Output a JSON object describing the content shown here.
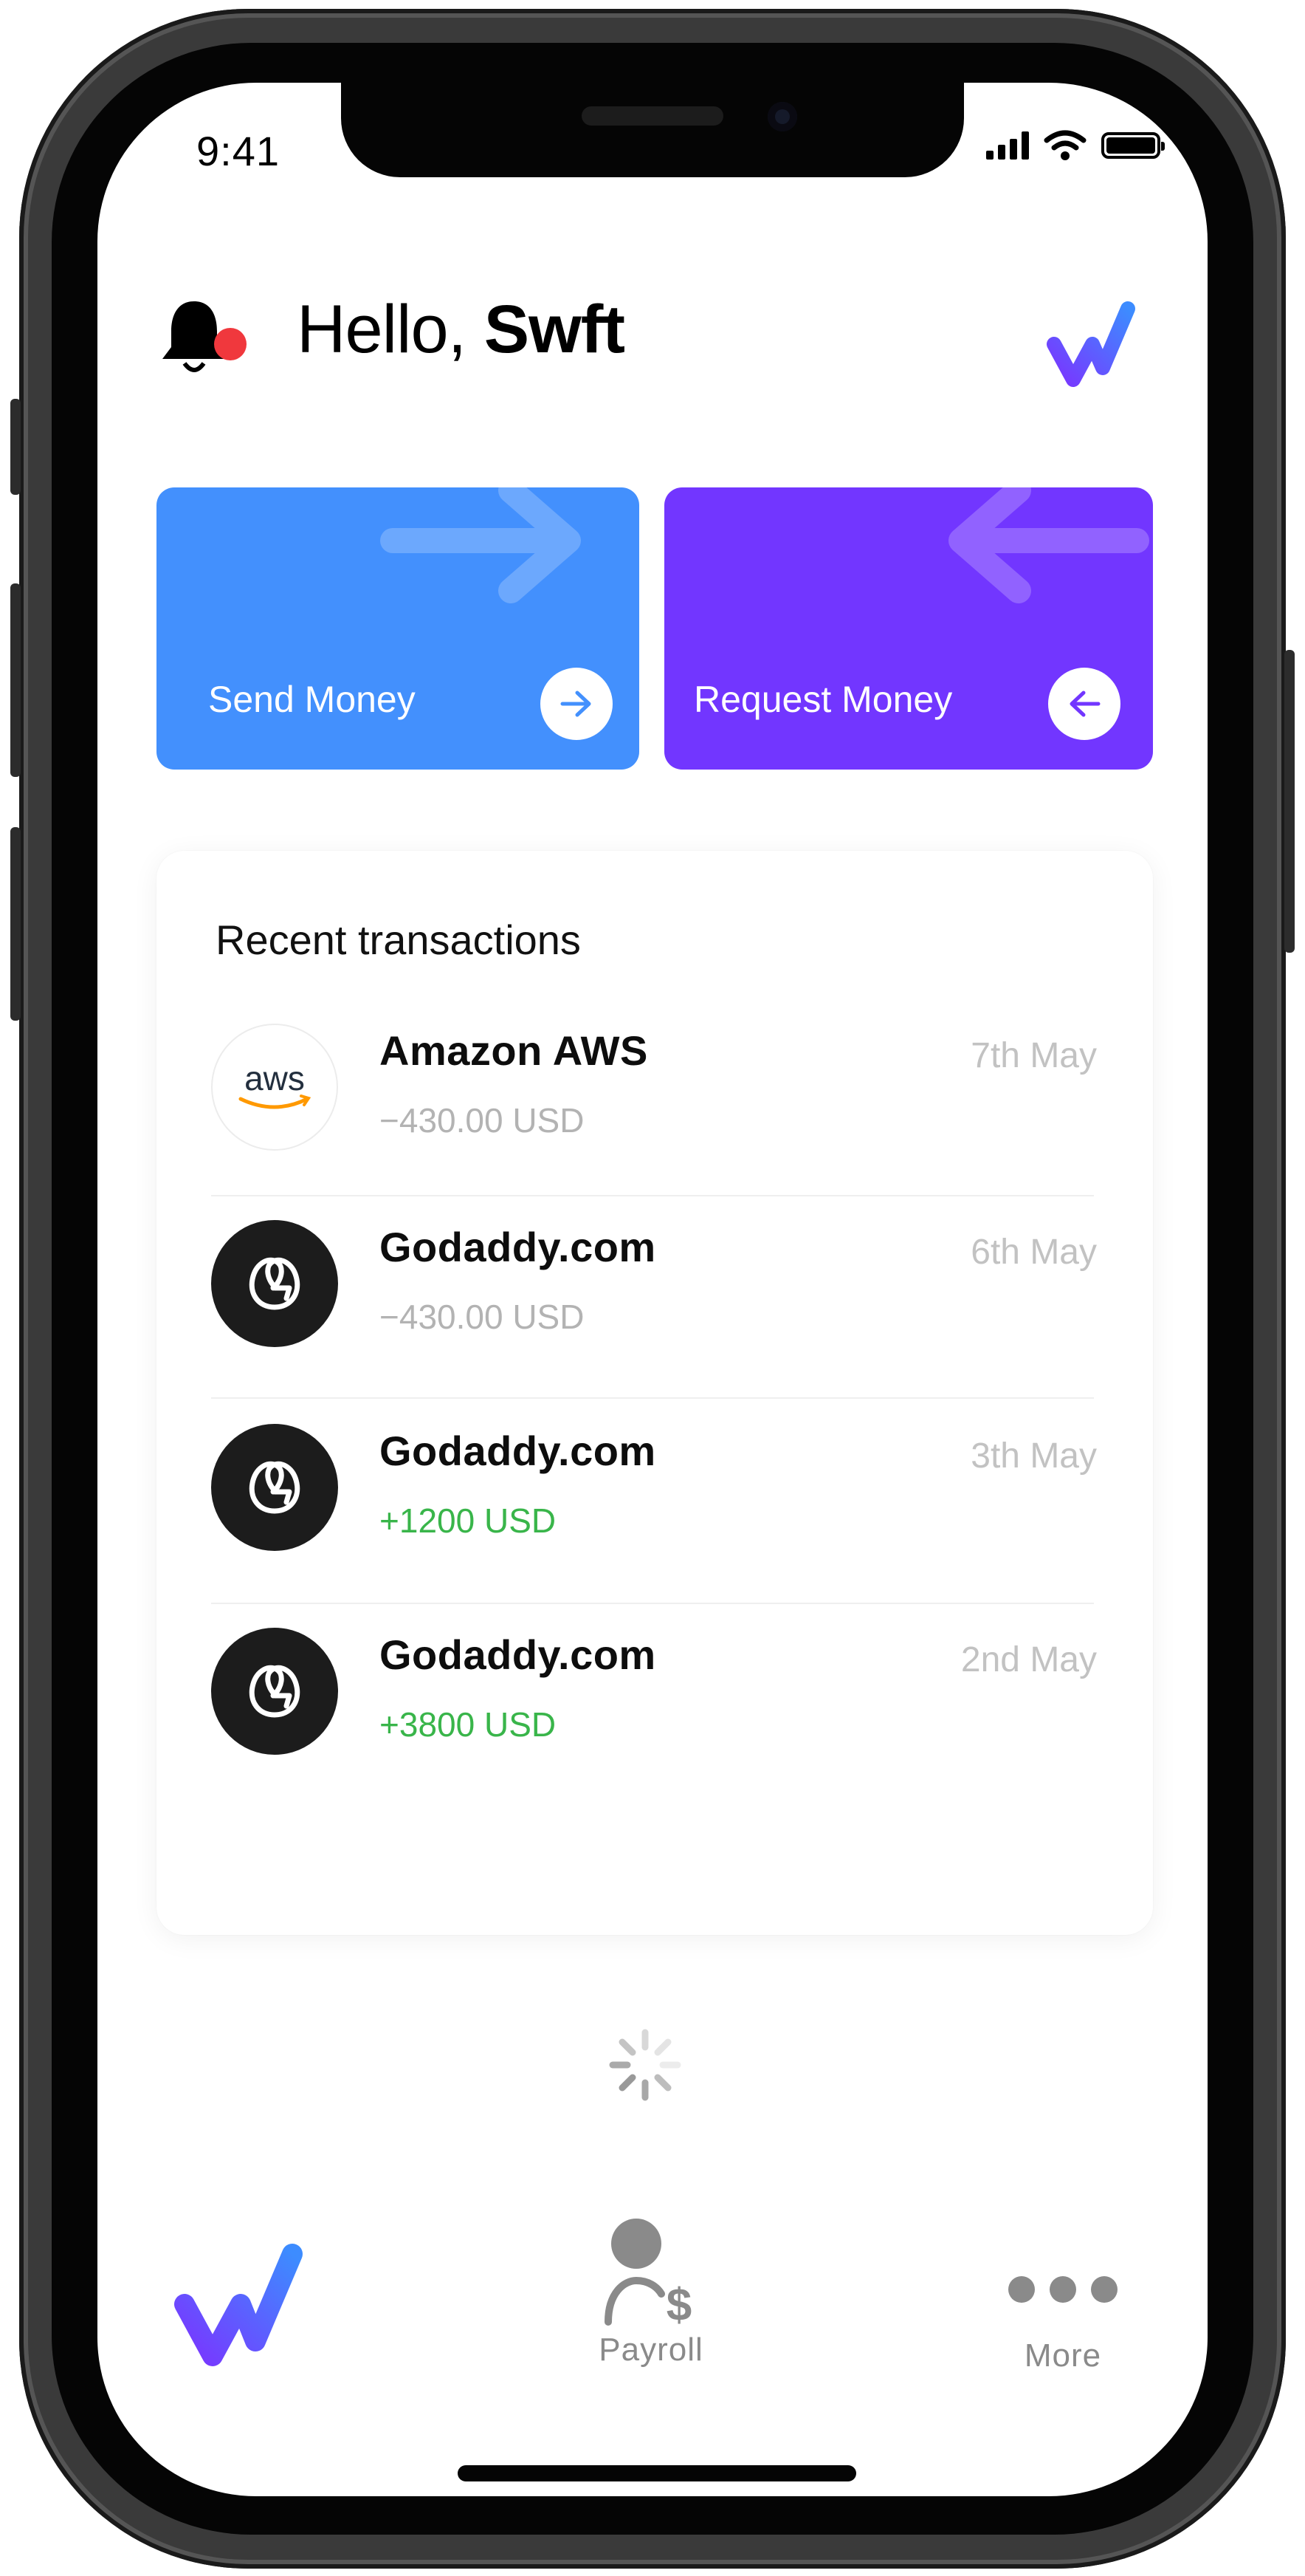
{
  "status_bar": {
    "time": "9:41"
  },
  "header": {
    "greeting_prefix": "Hello, ",
    "greeting_name": "Swft",
    "notification_dot_color": "#f0383d"
  },
  "actions": {
    "send": {
      "label": "Send Money",
      "color": "#4390fd"
    },
    "request": {
      "label": "Request Money",
      "color": "#7236ff"
    }
  },
  "transactions": {
    "title": "Recent transactions",
    "items": [
      {
        "name": "Amazon AWS",
        "amount": "−430.00 USD",
        "date": "7th May",
        "logo": "aws-logo",
        "logo_text": "aws",
        "direction": "out"
      },
      {
        "name": "Godaddy.com",
        "amount": "−430.00 USD",
        "date": "6th May",
        "logo": "godaddy-logo",
        "direction": "out"
      },
      {
        "name": "Godaddy.com",
        "amount": "+1200 USD",
        "date": "3th May",
        "logo": "godaddy-logo",
        "direction": "in"
      },
      {
        "name": "Godaddy.com",
        "amount": "+3800 USD",
        "date": "2nd May",
        "logo": "godaddy-logo",
        "direction": "in"
      }
    ]
  },
  "tab_bar": {
    "home_icon": "swft-logo",
    "payroll_label": "Payroll",
    "more_label": "More"
  },
  "colors": {
    "positive_amount": "#39b54a",
    "negative_amount": "#b3b3b3"
  }
}
